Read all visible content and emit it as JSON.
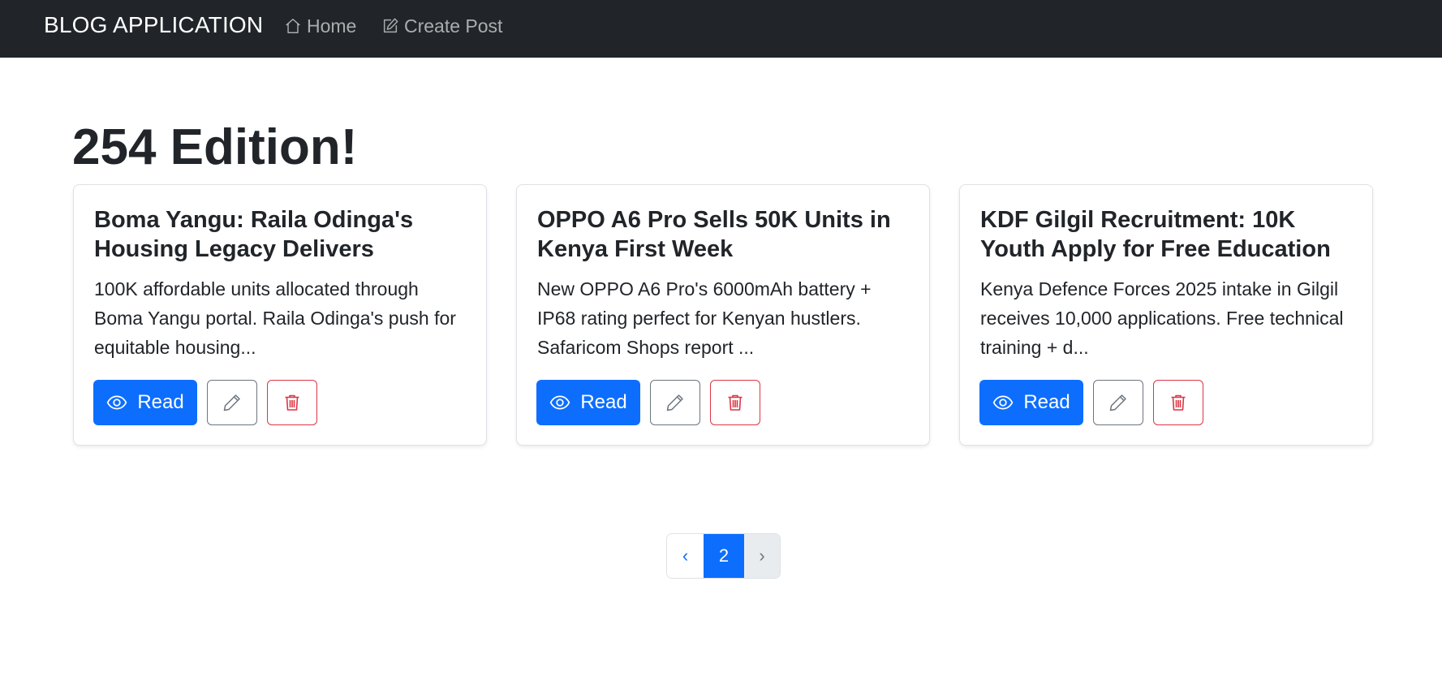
{
  "navbar": {
    "brand": "BLOG APPLICATION",
    "links": [
      {
        "label": "Home",
        "icon": "house-icon"
      },
      {
        "label": "Create Post",
        "icon": "pencil-square-icon"
      }
    ]
  },
  "main": {
    "title": "254 Edition!",
    "posts": [
      {
        "title": "Boma Yangu: Raila Odinga's Housing Legacy Delivers",
        "excerpt": "100K affordable units allocated through Boma Yangu portal. Raila Odinga's push for equitable housing...",
        "read_label": "Read"
      },
      {
        "title": "OPPO A6 Pro Sells 50K Units in Kenya First Week",
        "excerpt": "New OPPO A6 Pro's 6000mAh battery + IP68 rating perfect for Kenyan hustlers. Safaricom Shops report ...",
        "read_label": "Read"
      },
      {
        "title": "KDF Gilgil Recruitment: 10K Youth Apply for Free Education",
        "excerpt": "Kenya Defence Forces 2025 intake in Gilgil receives 10,000 applications. Free technical training + d...",
        "read_label": "Read"
      }
    ]
  },
  "pagination": {
    "prev": "‹",
    "current": "2",
    "next": "›"
  },
  "colors": {
    "navbar_bg": "#212529",
    "primary": "#0d6efd",
    "secondary": "#6c757d",
    "danger": "#dc3545"
  }
}
